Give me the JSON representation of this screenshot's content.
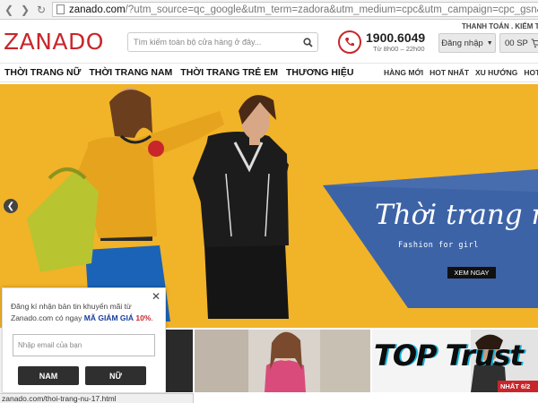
{
  "browser": {
    "url_host": "zanado.com",
    "url_rest": "/?utm_source=qc_google&utm_term=zadora&utm_medium=cpc&utm_campaign=cpc_gsn&utm_conte"
  },
  "header": {
    "logo": "ZANADO",
    "search_placeholder": "Tìm kiếm toàn bộ cửa hàng ở đây...",
    "phone_number": "1900.6049",
    "phone_hours": "Từ 8h00 – 22h00",
    "top_links": "THANH TOÁN . KIỂM TI",
    "login_label": "Đăng nhập",
    "cart_label": "00 SP"
  },
  "nav": {
    "main": [
      "THỜI TRANG NỮ",
      "THỜI TRANG NAM",
      "THỜI TRANG TRẺ EM",
      "THƯƠNG HIỆU"
    ],
    "secondary": [
      "HÀNG MỚI",
      "HOT NHẤT",
      "XU HƯỚNG",
      "HOT DE"
    ]
  },
  "banner": {
    "script_title": "Thời trang nữ",
    "subtitle": "Fashion for girl",
    "cta": "XEM NGAY"
  },
  "thumbnails": {
    "promo_text": "TOP Trust",
    "corner_badge": "NHẤT 6/2"
  },
  "popup": {
    "text_prefix": "Đăng kí nhận bản tin khuyến mãi từ Zanado.com có ngay ",
    "code_label": "MÃ GIẢM GIÁ ",
    "discount": "10%",
    "text_suffix": ".",
    "email_placeholder": "Nhập email của bạn",
    "btn_male": "NAM",
    "btn_female": "NỮ"
  },
  "status_bar": "zanado.com/thoi-trang-nu-17.html",
  "colors": {
    "brand_red": "#c8262b",
    "banner_yellow": "#f1b328",
    "banner_blue": "#3d63a7"
  }
}
